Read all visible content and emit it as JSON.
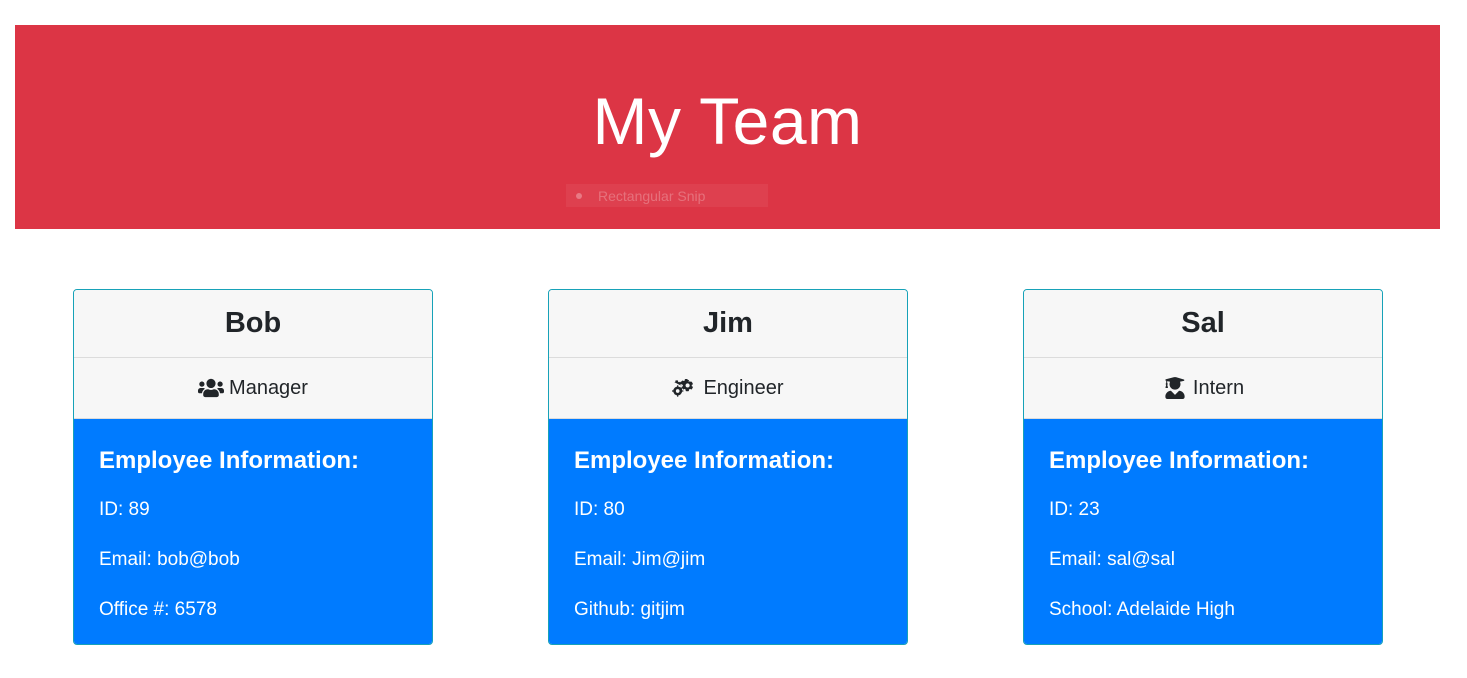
{
  "header": {
    "title": "My Team",
    "snip_label": "Rectangular Snip"
  },
  "section_title": "Employee Information:",
  "employees": [
    {
      "name": "Bob",
      "role": "Manager",
      "role_icon": "users-icon",
      "lines": [
        "ID: 89",
        "Email: bob@bob",
        "Office #: 6578"
      ]
    },
    {
      "name": "Jim",
      "role": "Engineer",
      "role_icon": "cogs-icon",
      "lines": [
        "ID: 80",
        "Email: Jim@jim",
        "Github: gitjim"
      ]
    },
    {
      "name": "Sal",
      "role": "Intern",
      "role_icon": "graduate-icon",
      "lines": [
        "ID: 23",
        "Email: sal@sal",
        "School: Adelaide High"
      ]
    }
  ],
  "colors": {
    "header_bg": "#dc3545",
    "card_body_bg": "#007bff",
    "card_border": "#17a2b8"
  }
}
